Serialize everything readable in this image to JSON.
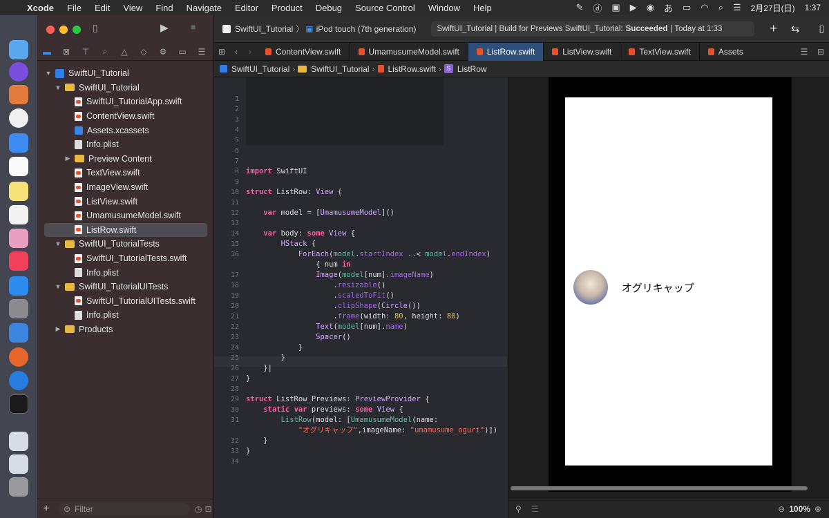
{
  "menubar": {
    "items": [
      "Xcode",
      "File",
      "Edit",
      "View",
      "Find",
      "Navigate",
      "Editor",
      "Product",
      "Debug",
      "Source Control",
      "Window",
      "Help"
    ],
    "date": "2月27日(日)",
    "time": "1:37",
    "input_method": "あ"
  },
  "toolbar": {
    "scheme": "SwiftUI_Tutorial",
    "device": "iPod touch (7th generation)",
    "status_prefix": "SwiftUI_Tutorial | Build for Previews SwiftUI_Tutorial:",
    "status_result": "Succeeded",
    "status_time": "| Today at 1:33"
  },
  "tabs": [
    {
      "label": "ContentView.swift"
    },
    {
      "label": "UmamusumeModel.swift"
    },
    {
      "label": "ListRow.swift"
    },
    {
      "label": "ListView.swift"
    },
    {
      "label": "TextView.swift"
    },
    {
      "label": "Assets"
    }
  ],
  "jumpbar": [
    "SwiftUI_Tutorial",
    "SwiftUI_Tutorial",
    "ListRow.swift",
    "ListRow"
  ],
  "navigator": {
    "rows": [
      {
        "label": "SwiftUI_Tutorial",
        "kind": "project",
        "level": 0,
        "open": true
      },
      {
        "label": "SwiftUI_Tutorial",
        "kind": "folder",
        "level": 1,
        "open": true
      },
      {
        "label": "SwiftUI_TutorialApp.swift",
        "kind": "swift",
        "level": 2
      },
      {
        "label": "ContentView.swift",
        "kind": "swift",
        "level": 2
      },
      {
        "label": "Assets.xcassets",
        "kind": "assets",
        "level": 2
      },
      {
        "label": "Info.plist",
        "kind": "plist",
        "level": 2
      },
      {
        "label": "Preview Content",
        "kind": "folder",
        "level": 2,
        "open": false
      },
      {
        "label": "TextView.swift",
        "kind": "swift",
        "level": 2
      },
      {
        "label": "ImageView.swift",
        "kind": "swift",
        "level": 2
      },
      {
        "label": "ListView.swift",
        "kind": "swift",
        "level": 2
      },
      {
        "label": "UmamusumeModel.swift",
        "kind": "swift",
        "level": 2
      },
      {
        "label": "ListRow.swift",
        "kind": "swift",
        "level": 2,
        "selected": true
      },
      {
        "label": "SwiftUI_TutorialTests",
        "kind": "folder",
        "level": 1,
        "open": true
      },
      {
        "label": "SwiftUI_TutorialTests.swift",
        "kind": "swift",
        "level": 2
      },
      {
        "label": "Info.plist",
        "kind": "plist",
        "level": 2
      },
      {
        "label": "SwiftUI_TutorialUITests",
        "kind": "folder",
        "level": 1,
        "open": true
      },
      {
        "label": "SwiftUI_TutorialUITests.swift",
        "kind": "swift",
        "level": 2
      },
      {
        "label": "Info.plist",
        "kind": "plist",
        "level": 2
      },
      {
        "label": "Products",
        "kind": "folder",
        "level": 1,
        "open": false
      }
    ],
    "filter_placeholder": "Filter"
  },
  "editor": {
    "lines": [
      {
        "n": "1",
        "html": ""
      },
      {
        "n": "2",
        "html": ""
      },
      {
        "n": "3",
        "html": ""
      },
      {
        "n": "4",
        "html": ""
      },
      {
        "n": "5",
        "html": ""
      },
      {
        "n": "6",
        "html": ""
      },
      {
        "n": "7",
        "html": ""
      },
      {
        "n": "8",
        "html": "<span class='kw'>import</span> SwiftUI"
      },
      {
        "n": "9",
        "html": ""
      },
      {
        "n": "10",
        "html": "<span class='kw'>struct</span> ListRow: <span class='ty'>View</span> {"
      },
      {
        "n": "11",
        "html": ""
      },
      {
        "n": "12",
        "html": "    <span class='kw'>var</span> model = [<span class='ty'>UmamusumeModel</span>]()"
      },
      {
        "n": "13",
        "html": ""
      },
      {
        "n": "14",
        "html": "    <span class='kw'>var</span> body: <span class='kw'>some</span> <span class='ty'>View</span> {"
      },
      {
        "n": "15",
        "html": "        <span class='ty'>HStack</span> {"
      },
      {
        "n": "16",
        "html": "            <span class='ty'>ForEach</span>(<span class='fn'>model</span>.<span class='pr'>startIndex</span> ..< <span class='fn'>model</span>.<span class='pr'>endIndex</span>)"
      },
      {
        "n": "",
        "html": "                { num <span class='kw'>in</span>"
      },
      {
        "n": "17",
        "html": "                <span class='ty'>Image</span>(<span class='fn'>model</span>[num].<span class='pr'>imageName</span>)"
      },
      {
        "n": "18",
        "html": "                    .<span class='pr'>resizable</span>()"
      },
      {
        "n": "19",
        "html": "                    .<span class='pr'>scaledToFit</span>()"
      },
      {
        "n": "20",
        "html": "                    .<span class='pr'>clipShape</span>(<span class='ty'>Circle</span>())"
      },
      {
        "n": "21",
        "html": "                    .<span class='pr'>frame</span>(width: <span class='nu'>80</span>, height: <span class='nu'>80</span>)"
      },
      {
        "n": "22",
        "html": "                <span class='ty'>Text</span>(<span class='fn'>model</span>[num].<span class='pr'>name</span>)"
      },
      {
        "n": "23",
        "html": "                <span class='ty'>Spacer</span>()"
      },
      {
        "n": "24",
        "html": "            }"
      },
      {
        "n": "25",
        "html": "        }"
      },
      {
        "n": "26",
        "html": "    }|"
      },
      {
        "n": "27",
        "html": "}"
      },
      {
        "n": "28",
        "html": ""
      },
      {
        "n": "29",
        "html": "<span class='kw'>struct</span> ListRow_Previews: <span class='ty'>PreviewProvider</span> {"
      },
      {
        "n": "30",
        "html": "    <span class='kw'>static</span> <span class='kw'>var</span> previews: <span class='kw'>some</span> <span class='ty'>View</span> {"
      },
      {
        "n": "31",
        "html": "        <span class='fn'>ListRow</span>(model: [<span class='fn'>UmamusumeModel</span>(name:"
      },
      {
        "n": "",
        "html": "            <span class='st'>\"オグリキャップ\"</span>,imageName: <span class='st'>\"umamusume_oguri\"</span>)])"
      },
      {
        "n": "32",
        "html": "    }"
      },
      {
        "n": "33",
        "html": "}"
      },
      {
        "n": "34",
        "html": ""
      }
    ]
  },
  "preview": {
    "row_name": "オグリキャップ",
    "zoom": "100%"
  }
}
